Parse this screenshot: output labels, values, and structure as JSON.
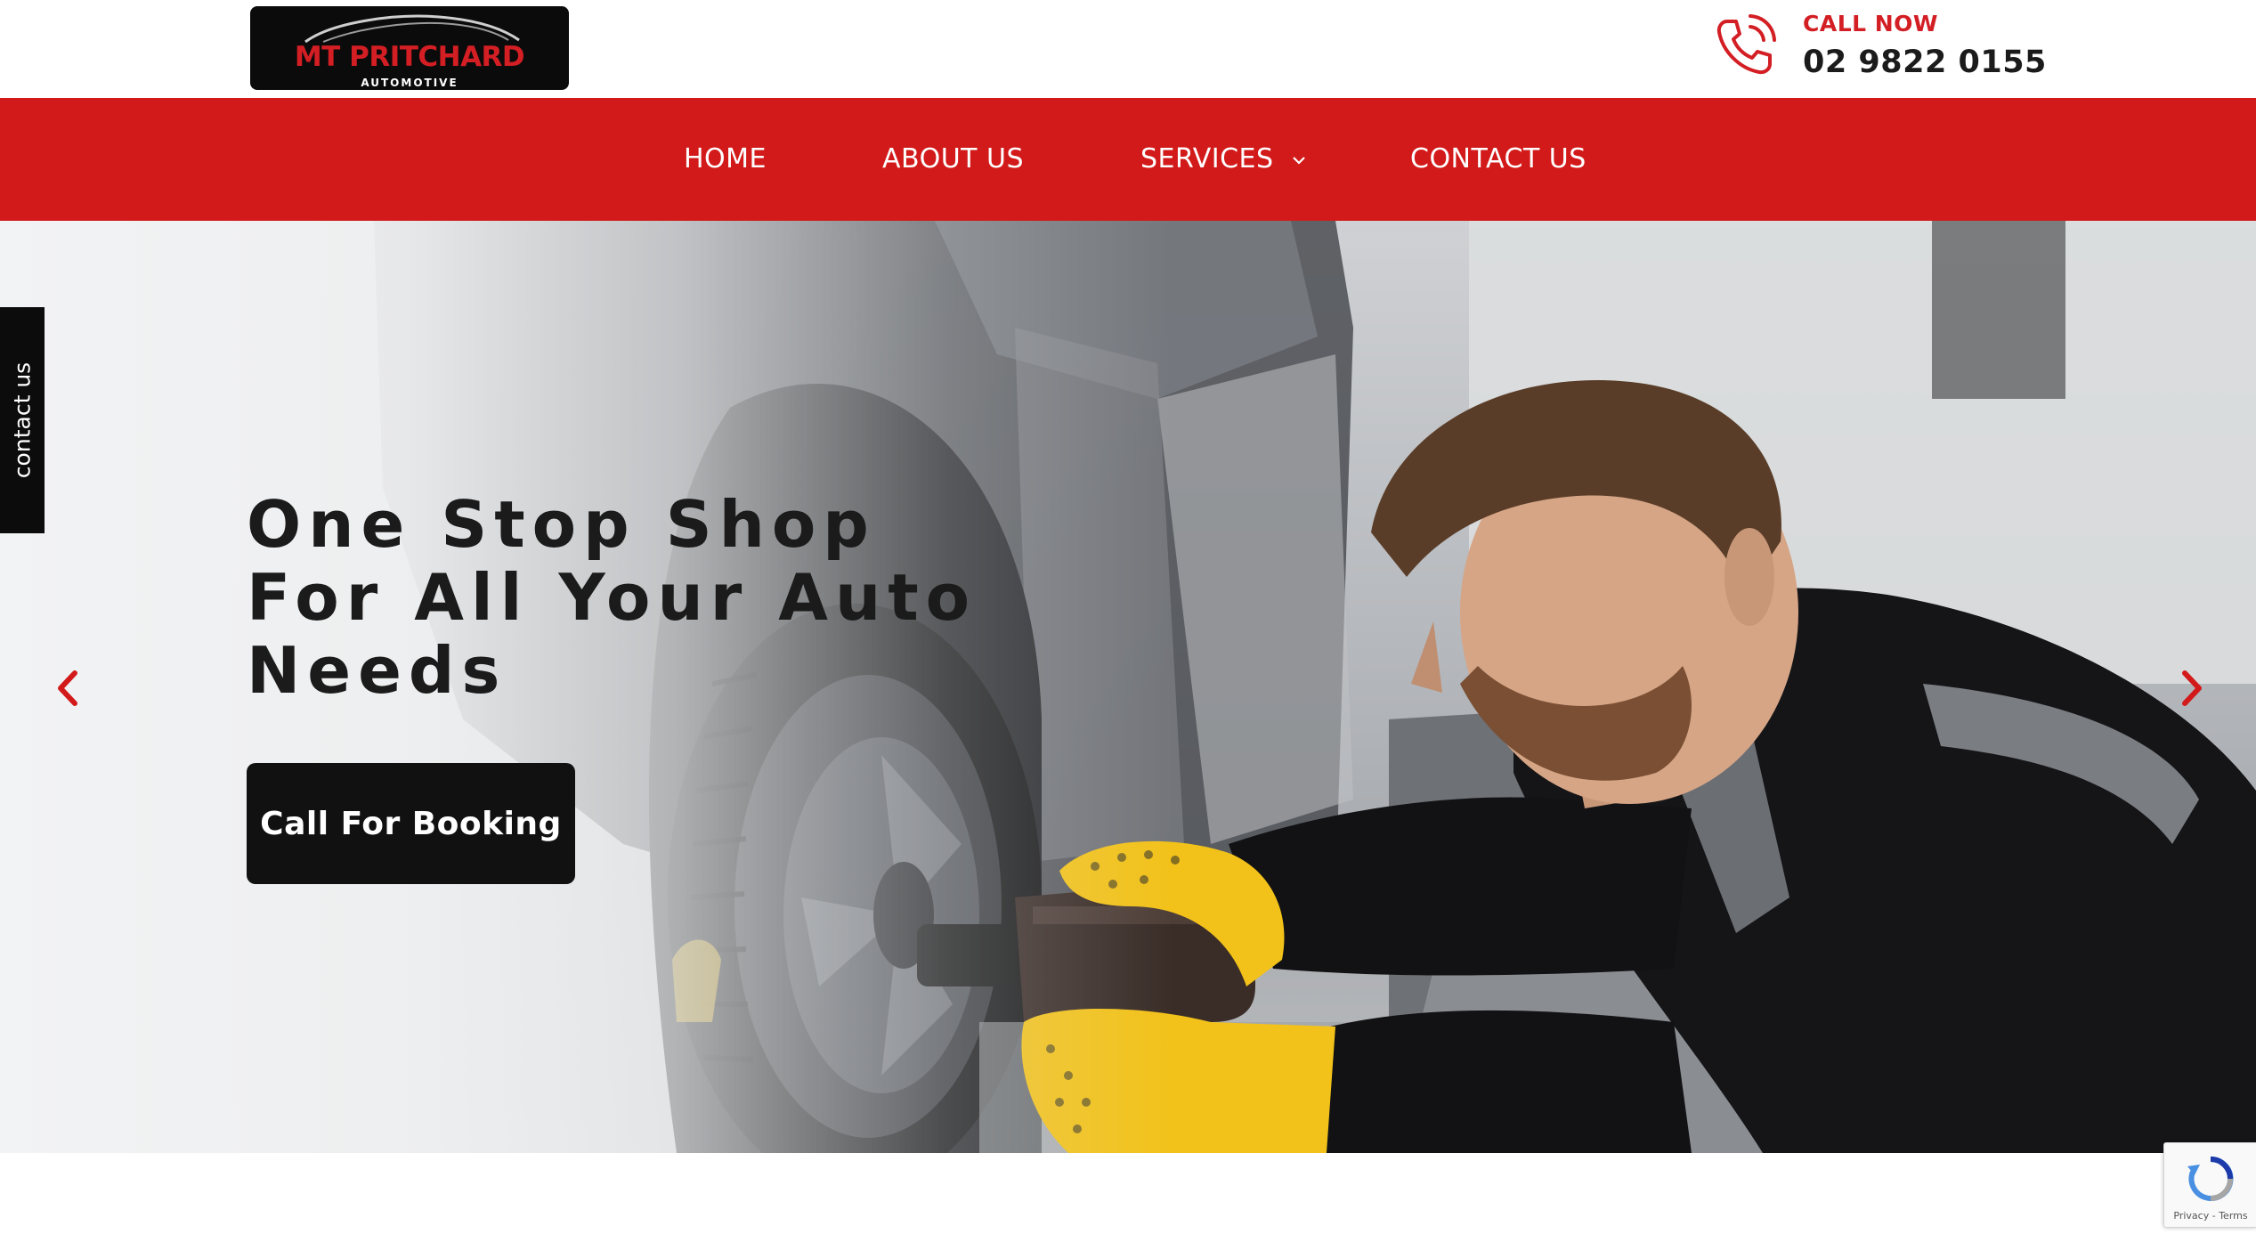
{
  "brand": {
    "logo_text": "MT PRITCHARD",
    "logo_subtext": "AUTOMOTIVE"
  },
  "contact": {
    "call_label": "CALL NOW",
    "phone": "02 9822 0155",
    "icon": "phone-icon"
  },
  "nav": {
    "items": [
      {
        "label": "HOME"
      },
      {
        "label": "ABOUT US"
      },
      {
        "label": "SERVICES",
        "icon": "chevron-down-icon"
      },
      {
        "label": "CONTACT US"
      }
    ]
  },
  "hero": {
    "title": "One Stop Shop For All Your Auto Needs",
    "button_label": "Call For Booking",
    "prev_icon": "chevron-left-icon",
    "next_icon": "chevron-right-icon"
  },
  "side_tab": {
    "label": "contact us"
  },
  "recaptcha": {
    "terms": "Privacy - Terms"
  },
  "colors": {
    "accent_red": "#d31a1a",
    "dark": "#111111",
    "glove_yellow": "#f2c21a"
  }
}
